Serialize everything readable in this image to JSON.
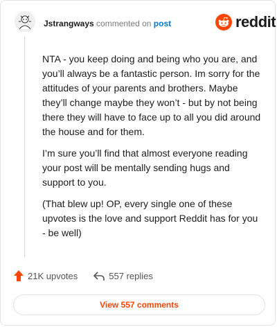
{
  "header": {
    "username": "Jstrangways",
    "commented_on": "commented on",
    "post_link": "post"
  },
  "brand": {
    "name": "reddit",
    "icon": "reddit-snoo-icon",
    "color": "#ff4500"
  },
  "comment": {
    "paragraphs": [
      "NTA - you keep doing and being who you are, and you’ll always be a fantastic person. Im sorry for the attitudes of your parents and brothers. Maybe they’ll change maybe they won’t - but by not being there they will have to face up to all you did around the house and for them.",
      "I’m sure you’ll find that almost everyone reading your post will be mentally sending hugs and support to you.",
      "(That blew up! OP, every single one of these upvotes is the love and support Reddit has for you - be well)"
    ]
  },
  "actions": {
    "upvotes": "21K upvotes",
    "upvote_icon": "upvote-arrow-icon",
    "replies": "557 replies",
    "reply_icon": "reply-arrow-icon"
  },
  "footer": {
    "view_comments": "View 557 comments"
  }
}
